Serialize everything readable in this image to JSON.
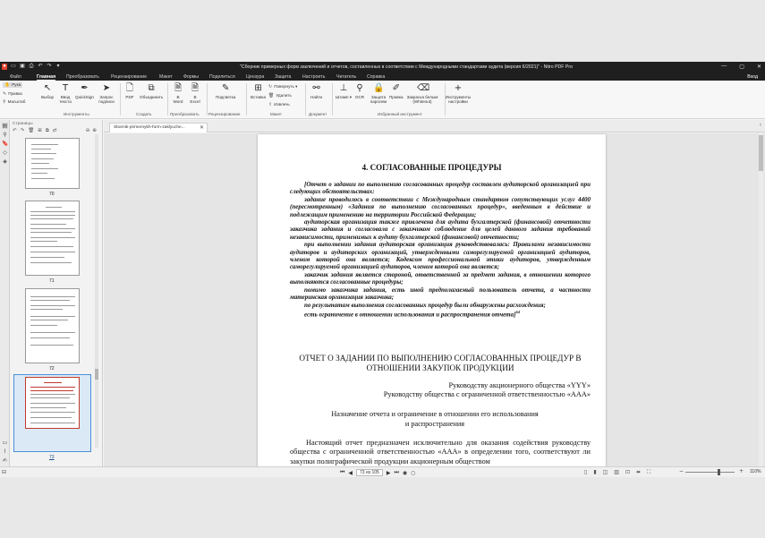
{
  "app": {
    "title": "\"Сборник примерных форм заключений и отчетов, составленных в соответствии с Международными стандартами аудита (версия 6/2021)\" - Nitro PDF Pro",
    "login": "Вход"
  },
  "menu": [
    "Файл",
    "Главная",
    "Преобразовать",
    "Рецензирование",
    "Макет",
    "Формы",
    "Поделиться",
    "Цензура",
    "Защита",
    "Настроить",
    "Читатель",
    "Справка"
  ],
  "ribbon": {
    "left_tools": [
      "Рука",
      "Правка",
      "Масштаб"
    ],
    "tools": {
      "select": "Выбор",
      "type_text": "Ввод текста",
      "quicksign": "QuickSign",
      "request_sign": "Запрос подписи",
      "pdf": "PDF",
      "combine": "Объединить",
      "to_word": "В Word",
      "to_excel": "В Excel",
      "highlight": "Подсветка",
      "insert": "Вставка",
      "rotate": "Повернуть",
      "delete": "Удалить",
      "extract": "Извлечь",
      "find": "Найти",
      "stamp": "Штамп",
      "ocr": "OCR",
      "protect": "Защита паролем",
      "edit": "Правка",
      "whiteout": "Закраска белым (Whiteout)",
      "customize": "Инструменты настройки"
    },
    "groups": {
      "tools": "Инструменты",
      "create": "Создать",
      "convert": "Преобразовать",
      "review": "Рецензирование",
      "layout": "Макет",
      "document": "Документ",
      "favorites": "Избранный инструмент"
    }
  },
  "icons": {
    "hand": "hand-icon",
    "edit": "edit-icon",
    "zoom": "zoom-icon",
    "select": "cursor-icon",
    "text": "text-icon",
    "sign": "pen-icon"
  },
  "sidebar": {
    "header": "Страницы",
    "thumbs": [
      {
        "label": "70"
      },
      {
        "label": "71"
      },
      {
        "label": "72"
      },
      {
        "label": "73"
      }
    ]
  },
  "doc_tab": {
    "name": "Sbornik-primernykh-form-zaklyuche..."
  },
  "page": {
    "heading": "4. СОГЛАСОВАННЫЕ ПРОЦЕДУРЫ",
    "italic_paragraphs": [
      "[Отчет о задании по выполнению согласованных процедур составлен аудиторской организацией при следующих обстоятельствах:",
      "задание проводилось в соответствии с Международным стандартом сопутствующих услуг 4400 (пересмотренным) «Задания по выполнению согласованных процедур», введенным в действие и подлежащим применению на территории Российской Федерации;",
      "аудиторская организация также привлечена для аудита бухгалтерской (финансовой) отчетности заказчика задания и согласовала с заказчиком соблюдение для целей данного задания требований независимости, применимых к аудиту бухгалтерской (финансовой) отчетности;",
      "при выполнении задания аудиторская организация руководствовалась: Правилами независимости аудиторов и аудиторских организаций, утвержденными саморегулируемой организацией аудиторов, членом которой она является; Кодексом профессиональной этики аудиторов, утвержденным саморегулируемой организацией аудиторов, членом которой она является;",
      "заказчик задания является стороной, ответственной за предмет задания, в отношении которого выполняются согласованные процедуры;",
      "помимо заказчика задания, есть иной предполагаемый пользователь отчета, а частности материнская организация заказчика;",
      "по результатам выполнения согласованных процедур были обнаружены расхождения;",
      "есть ограничение в отношении использования и распространения отчета]"
    ],
    "footnote_ref": "64",
    "report_title": "ОТЧЕТ О ЗАДАНИИ ПО ВЫПОЛНЕНИЮ СОГЛАСОВАННЫХ ПРОЦЕДУР В ОТНОШЕНИИ ЗАКУПОК ПРОДУКЦИИ",
    "addressee_1": "Руководству акционерного общества «YYY»",
    "addressee_2": "Руководству общества с ограниченной ответственностью «AAA»",
    "section_title": "Назначение отчета и ограничение в отношении его использования и распространения",
    "body": "Настоящий отчет предназначен исключительно для оказания содействия руководству общества с ограниченной ответственностью «AAA» в определении того, соответствуют ли закупки полиграфической продукции акционерным обществом"
  },
  "status": {
    "page_indicator": "73 из 105",
    "zoom": "110%"
  }
}
